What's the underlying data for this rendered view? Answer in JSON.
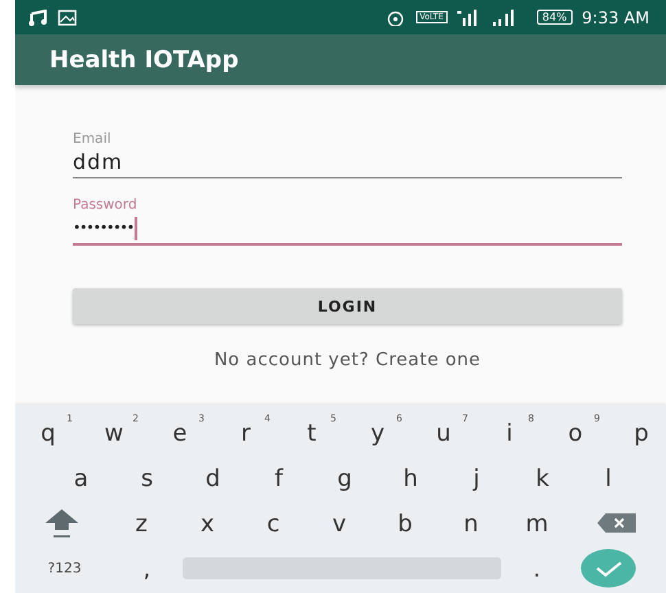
{
  "status_bar": {
    "battery": "84%",
    "network_label": "VoLTE",
    "time": "9:33 AM"
  },
  "app_bar": {
    "title": "Health IOTApp"
  },
  "form": {
    "fields": [
      {
        "label": "Email",
        "value": "ddm",
        "focused": false,
        "kind": "text"
      },
      {
        "label": "Password",
        "value": "•••••••••",
        "focused": true,
        "kind": "password"
      }
    ],
    "button": "LOGIN",
    "link": "No account yet? Create one"
  },
  "keyboard": {
    "rows": [
      [
        {
          "kind": "letter",
          "label": "q",
          "hint": "1"
        },
        {
          "kind": "letter",
          "label": "w",
          "hint": "2"
        },
        {
          "kind": "letter",
          "label": "e",
          "hint": "3"
        },
        {
          "kind": "letter",
          "label": "r",
          "hint": "4"
        },
        {
          "kind": "letter",
          "label": "t",
          "hint": "5"
        },
        {
          "kind": "letter",
          "label": "y",
          "hint": "6"
        },
        {
          "kind": "letter",
          "label": "u",
          "hint": "7"
        },
        {
          "kind": "letter",
          "label": "i",
          "hint": "8"
        },
        {
          "kind": "letter",
          "label": "o",
          "hint": "9"
        },
        {
          "kind": "letter",
          "label": "p"
        }
      ],
      [
        {
          "kind": "letter",
          "label": "a"
        },
        {
          "kind": "letter",
          "label": "s"
        },
        {
          "kind": "letter",
          "label": "d"
        },
        {
          "kind": "letter",
          "label": "f"
        },
        {
          "kind": "letter",
          "label": "g"
        },
        {
          "kind": "letter",
          "label": "h"
        },
        {
          "kind": "letter",
          "label": "j"
        },
        {
          "kind": "letter",
          "label": "k"
        },
        {
          "kind": "letter",
          "label": "l"
        }
      ],
      [
        {
          "kind": "shift"
        },
        {
          "kind": "letter",
          "label": "z"
        },
        {
          "kind": "letter",
          "label": "x"
        },
        {
          "kind": "letter",
          "label": "c"
        },
        {
          "kind": "letter",
          "label": "v"
        },
        {
          "kind": "letter",
          "label": "b"
        },
        {
          "kind": "letter",
          "label": "n"
        },
        {
          "kind": "letter",
          "label": "m"
        },
        {
          "kind": "backspace"
        }
      ],
      [
        {
          "kind": "symbols",
          "label": "?123"
        },
        {
          "kind": "letter",
          "label": ","
        },
        {
          "kind": "space"
        },
        {
          "kind": "letter",
          "label": "."
        },
        {
          "kind": "enter"
        }
      ]
    ]
  }
}
